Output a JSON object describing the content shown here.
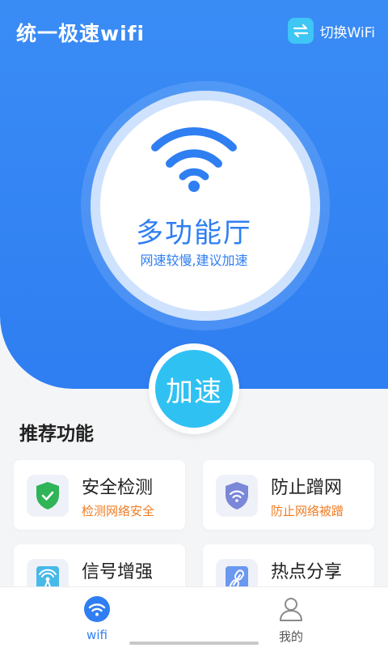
{
  "header": {
    "app_title": "统一极速wifi",
    "switch_label": "切换WiFi",
    "switch_icon": "swap-arrows-icon"
  },
  "hero": {
    "center_icon": "wifi-icon",
    "title": "多功能厅",
    "subtitle": "网速较慢,建议加速",
    "boost_label": "加速"
  },
  "section": {
    "title": "推荐功能"
  },
  "features": [
    {
      "title": "安全检测",
      "subtitle": "检测网络安全",
      "icon": "shield-check-icon",
      "color": "#2fb457"
    },
    {
      "title": "防止蹭网",
      "subtitle": "防止网络被蹭",
      "icon": "shield-wifi-icon",
      "color": "#7b87d8"
    },
    {
      "title": "信号增强",
      "subtitle": "",
      "icon": "signal-tower-icon",
      "color": "#48b9e8"
    },
    {
      "title": "热点分享",
      "subtitle": "",
      "icon": "link-icon",
      "color": "#6b98f0"
    }
  ],
  "tabs": [
    {
      "label": "wifi",
      "icon": "wifi-icon",
      "active": true
    },
    {
      "label": "我的",
      "icon": "user-icon",
      "active": false
    }
  ],
  "colors": {
    "primary": "#2f7ef2",
    "boost": "#30c1f3",
    "accent_orange": "#f07c22"
  }
}
